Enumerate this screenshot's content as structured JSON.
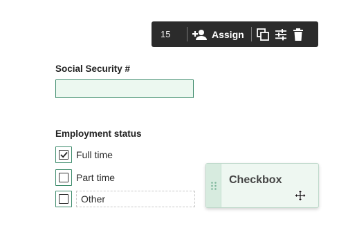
{
  "toolbar": {
    "number": "15",
    "assign_label": "Assign",
    "icons": [
      "assign-person-icon",
      "duplicate-icon",
      "settings-sliders-icon",
      "delete-icon"
    ]
  },
  "form": {
    "ssn_label": "Social Security #",
    "ssn_value": "",
    "employment_label": "Employment status",
    "options": [
      {
        "label": "Full time",
        "checked": true
      },
      {
        "label": "Part time",
        "checked": false
      },
      {
        "label": "Other",
        "checked": false
      }
    ]
  },
  "drag_card": {
    "title": "Checkbox",
    "icons": [
      "drag-handle-icon",
      "move-cursor-icon"
    ]
  },
  "colors": {
    "accent": "#3b8a6a",
    "field_fill": "#ecf8f0",
    "toolbar_bg": "#2b2b2b"
  }
}
